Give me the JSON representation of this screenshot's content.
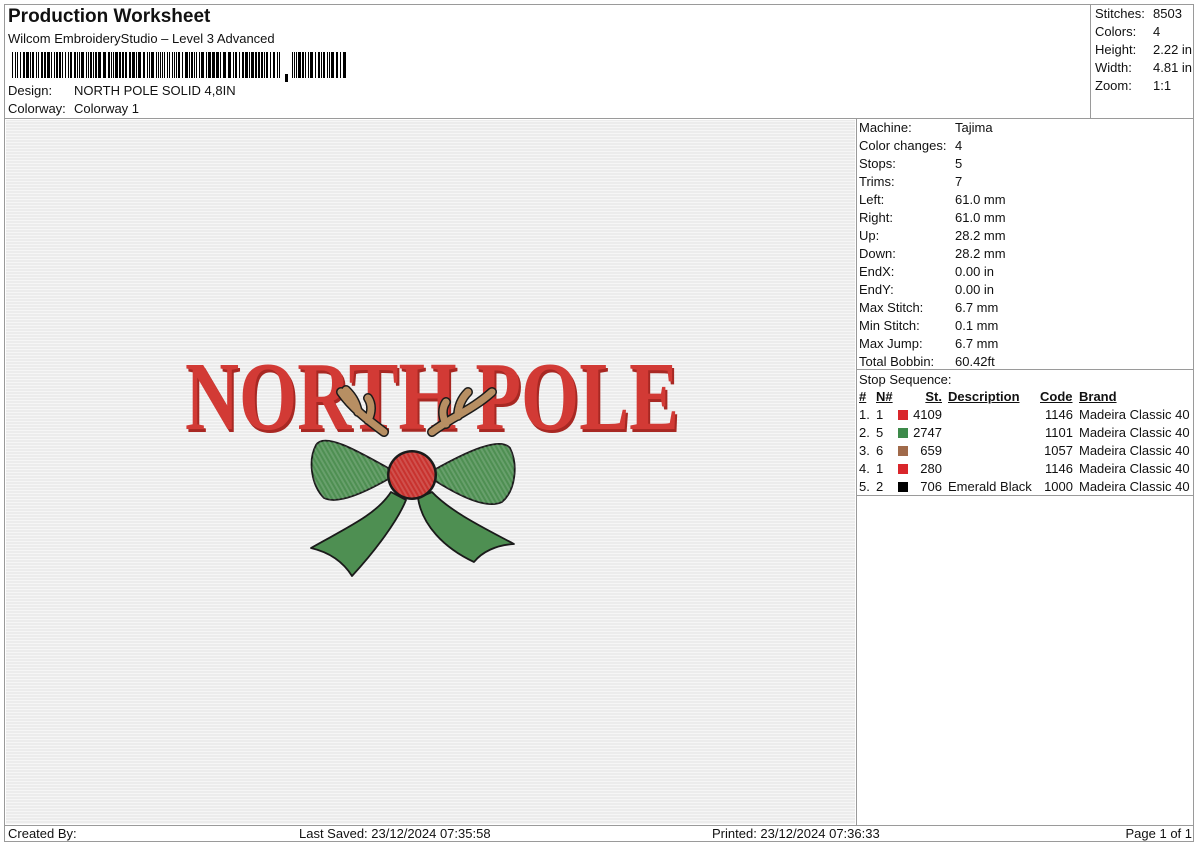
{
  "header": {
    "title": "Production Worksheet",
    "software": "Wilcom EmbroideryStudio – Level 3 Advanced",
    "design_label": "Design:",
    "design_value": "NORTH POLE SOLID 4,8IN",
    "colorway_label": "Colorway:",
    "colorway_value": "Colorway 1"
  },
  "summary": [
    {
      "label": "Stitches:",
      "value": "8503"
    },
    {
      "label": "Colors:",
      "value": "4"
    },
    {
      "label": "Height:",
      "value": "2.22 in"
    },
    {
      "label": "Width:",
      "value": "4.81 in"
    },
    {
      "label": "Zoom:",
      "value": "1:1"
    }
  ],
  "specs": [
    {
      "label": "Machine:",
      "value": "Tajima"
    },
    {
      "label": "Color changes:",
      "value": "4"
    },
    {
      "label": "Stops:",
      "value": "5"
    },
    {
      "label": "Trims:",
      "value": "7"
    },
    {
      "label": "Left:",
      "value": "61.0 mm"
    },
    {
      "label": "Right:",
      "value": "61.0 mm"
    },
    {
      "label": "Up:",
      "value": "28.2 mm"
    },
    {
      "label": "Down:",
      "value": "28.2 mm"
    },
    {
      "label": "EndX:",
      "value": "0.00 in"
    },
    {
      "label": "EndY:",
      "value": "0.00 in"
    },
    {
      "label": "Max Stitch:",
      "value": "6.7 mm"
    },
    {
      "label": "Min Stitch:",
      "value": "0.1 mm"
    },
    {
      "label": "Max Jump:",
      "value": "6.7 mm"
    },
    {
      "label": "Total Bobbin:",
      "value": "60.42ft"
    }
  ],
  "stop_sequence": {
    "title": "Stop Sequence:",
    "headers": {
      "index": "#",
      "needle": "N#",
      "stitches": "St.",
      "description": "Description",
      "code": "Code",
      "brand": "Brand"
    },
    "rows": [
      {
        "index": "1.",
        "needle": "1",
        "color": "#d9262b",
        "stitches": "4109",
        "description": "",
        "code": "1146",
        "brand": "Madeira Classic 40"
      },
      {
        "index": "2.",
        "needle": "5",
        "color": "#3d8a4a",
        "stitches": "2747",
        "description": "",
        "code": "1101",
        "brand": "Madeira Classic 40"
      },
      {
        "index": "3.",
        "needle": "6",
        "color": "#a06a4a",
        "stitches": "659",
        "description": "",
        "code": "1057",
        "brand": "Madeira Classic 40"
      },
      {
        "index": "4.",
        "needle": "1",
        "color": "#d9262b",
        "stitches": "280",
        "description": "",
        "code": "1146",
        "brand": "Madeira Classic 40"
      },
      {
        "index": "5.",
        "needle": "2",
        "color": "#000000",
        "stitches": "706",
        "description": "Emerald Black",
        "code": "1000",
        "brand": "Madeira Classic 40"
      }
    ]
  },
  "design_preview": {
    "text": "NORTH POLE",
    "colors": {
      "text": "#d23a35",
      "bow": "#4e8f52",
      "antler": "#b78f63",
      "nose": "#c8322e",
      "outline": "#1a1a1a"
    }
  },
  "footer": {
    "created_by": "Created By:",
    "last_saved": "Last Saved: 23/12/2024 07:35:58",
    "printed": "Printed: 23/12/2024 07:36:33",
    "page": "Page 1 of 1"
  }
}
